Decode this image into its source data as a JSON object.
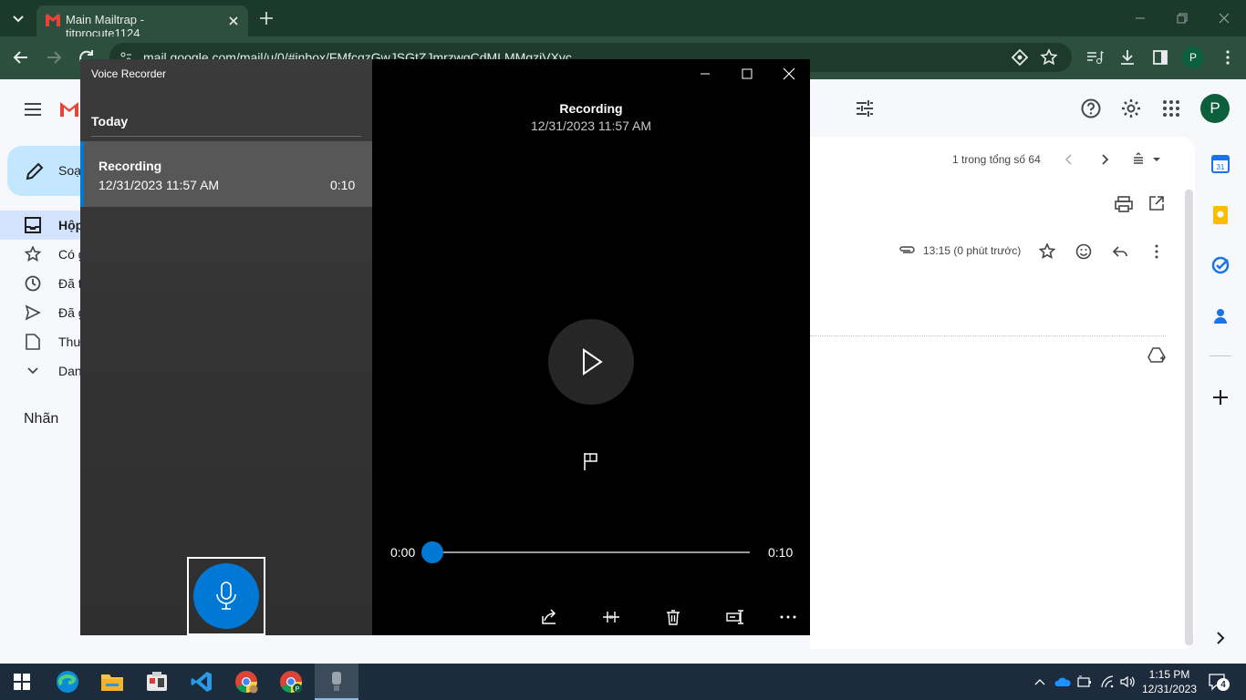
{
  "browser": {
    "tab_title": "Main Mailtrap - titprocute1124",
    "url": "mail.google.com/mail/u/0/#inbox/FMfcgzGwJSGtZJmrzwgCdMLMMgziVXvc",
    "profile_initial": "P"
  },
  "gmail": {
    "compose_label": "Soạ",
    "nav": [
      "Hộp",
      "Có g",
      "Đã t",
      "Đã g",
      "Thư",
      "Dan"
    ],
    "labels_heading": "Nhãn",
    "pagination": "1 trong tổng số 64",
    "timestamp": "13:15 (0 phút trước)",
    "avatar_initial": "P"
  },
  "voice_recorder": {
    "app_title": "Voice Recorder",
    "section": "Today",
    "list": [
      {
        "name": "Recording",
        "date": "12/31/2023 11:57 AM",
        "duration": "0:10"
      }
    ],
    "now_playing": {
      "title": "Recording",
      "date": "12/31/2023 11:57 AM"
    },
    "time_start": "0:00",
    "time_end": "0:10",
    "progress": 0
  },
  "taskbar": {
    "time": "1:15 PM",
    "date": "12/31/2023",
    "notification_count": "4"
  },
  "colors": {
    "accent": "#0078d4",
    "chrome_frame": "#1b3a2b",
    "gmail_bg": "#f6f8fc"
  }
}
